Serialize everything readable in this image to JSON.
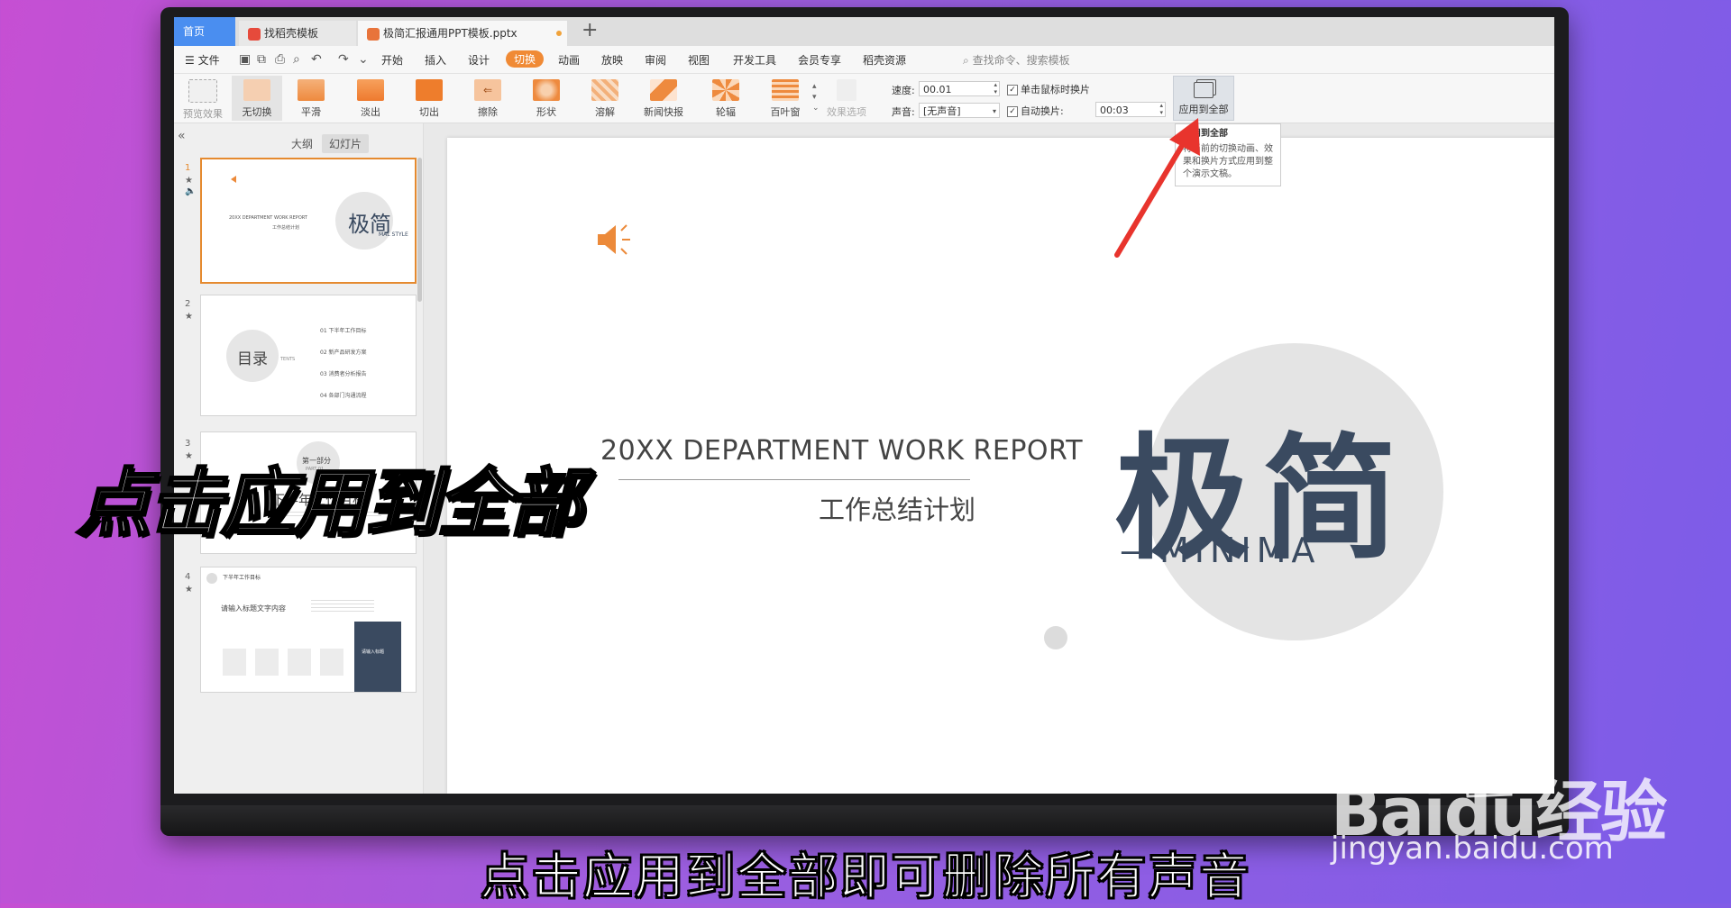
{
  "tabs": {
    "home": "首页",
    "template_store": "找稻壳模板",
    "file": "极简汇报通用PPT模板.pptx",
    "add": "+"
  },
  "menu": {
    "file": "文件",
    "items": [
      "开始",
      "插入",
      "设计",
      "切换",
      "动画",
      "放映",
      "审阅",
      "视图",
      "开发工具",
      "会员专享",
      "稻壳资源"
    ],
    "active": "切换",
    "search": "查找命令、搜索模板"
  },
  "ribbon": {
    "preview": "预览效果",
    "transitions": [
      "无切换",
      "平滑",
      "淡出",
      "切出",
      "擦除",
      "形状",
      "溶解",
      "新闻快报",
      "轮辐",
      "百叶窗"
    ],
    "effect_options": "效果选项",
    "speed_label": "速度:",
    "speed_value": "00.01",
    "sound_label": "声音:",
    "sound_value": "[无声音]",
    "on_click": "单击鼠标时换片",
    "auto_label": "自动换片:",
    "auto_value": "00:03",
    "apply_all": "应用到全部"
  },
  "tooltip": {
    "title": "应用到全部",
    "body": "将当前的切换动画、效果和换片方式应用到整个演示文稿。"
  },
  "panel": {
    "tab_outline": "大纲",
    "tab_slides": "幻灯片",
    "slide_numbers": [
      "1",
      "2",
      "3",
      "4"
    ],
    "slide1": {
      "label": "20XX DEPARTMENT WORK REPORT",
      "sub": "工作总结计划",
      "chars": "极简",
      "minimal": "MAL STYLE"
    },
    "slide2": {
      "title": "目录",
      "en": "TENTS",
      "items": [
        "01 下半年工作目标",
        "02 新产品研发方案",
        "03 消费者分析报告",
        "04 各部门沟通流程"
      ]
    },
    "slide3": {
      "part": "第一部分",
      "part_en": "PART 01",
      "title": "下半年工作目标"
    },
    "slide4": {
      "title": "下半年工作目标",
      "heading": "请输入标题文字内容",
      "card": "请输入标题"
    }
  },
  "slide": {
    "title": "20XX DEPARTMENT WORK REPORT",
    "subtitle": "工作总结计划",
    "big_chars": "极简",
    "minimal": "—MINIMA"
  },
  "overlay": {
    "caption": "点击应用到全部",
    "subtitle": "点击应用到全部即可删除所有声音"
  },
  "watermark": {
    "baidu": "Baidu经验",
    "url": "jingyan.baidu.com"
  },
  "colors": {
    "accent_orange": "#f08a35",
    "home_tab": "#4a8ef0",
    "slide_text": "#3a4a60",
    "arrow_red": "#e8342d"
  }
}
